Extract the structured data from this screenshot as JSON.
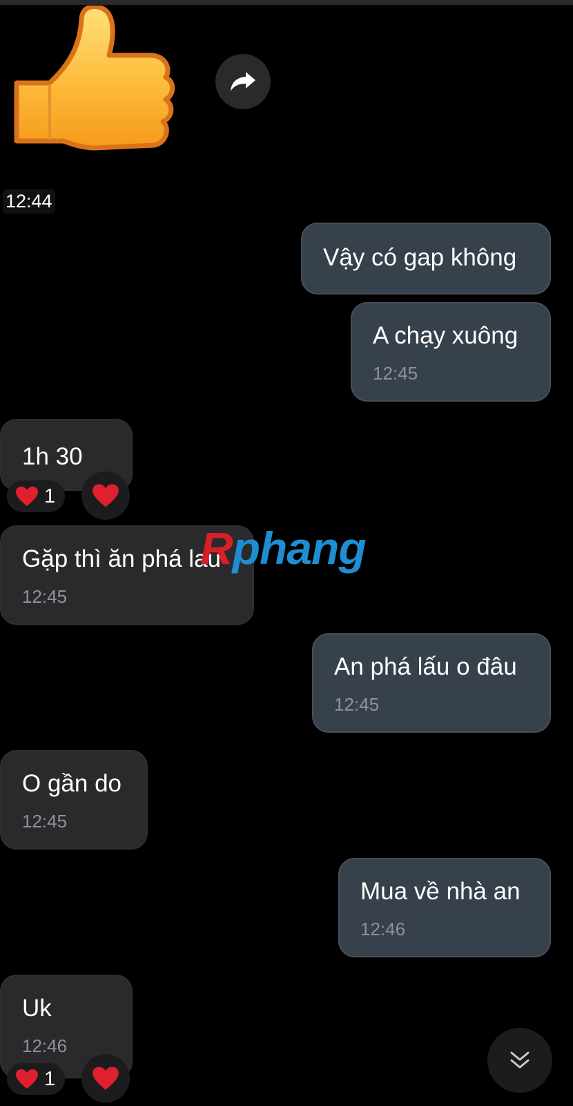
{
  "sticker": {
    "icon": "thumbs-up-sticker",
    "time": "12:44"
  },
  "share_button": {
    "icon": "share-arrow-icon"
  },
  "messages": [
    {
      "side": "out",
      "text": "Vậy có gap không",
      "time": ""
    },
    {
      "side": "out",
      "text": "A chạy xuông",
      "time": "12:45"
    },
    {
      "side": "in",
      "text": "1h 30",
      "time": "",
      "reaction": {
        "emoji": "heart",
        "count": "1"
      }
    },
    {
      "side": "in",
      "text": "Gặp thì ăn phá lau",
      "time": "12:45"
    },
    {
      "side": "out",
      "text": "An phá lấu o đâu",
      "time": "12:45"
    },
    {
      "side": "in",
      "text": "O gần do",
      "time": "12:45"
    },
    {
      "side": "out",
      "text": "Mua về nhà an",
      "time": "12:46"
    },
    {
      "side": "in",
      "text": "Uk",
      "time": "12:46",
      "reaction": {
        "emoji": "heart",
        "count": "1"
      }
    }
  ],
  "watermark": {
    "first": "R",
    "rest": "phang"
  },
  "scroll_button": {
    "icon": "double-chevron-down-icon"
  },
  "colors": {
    "background": "#000000",
    "outgoing_bubble": "#37414b",
    "incoming_bubble": "#2a2a2c",
    "time_text": "#8e9399",
    "heart": "#e0202e"
  }
}
